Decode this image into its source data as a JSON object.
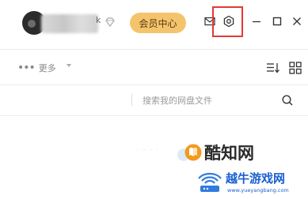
{
  "titlebar": {
    "username_suffix": "k",
    "member_center_label": "会员中心"
  },
  "icons": {
    "mail": "mail-icon",
    "settings": "gear-icon",
    "minimize": "minimize-icon",
    "maximize": "maximize-icon",
    "close": "close-icon",
    "diamond": "diamond-icon",
    "sort": "sort-icon",
    "grid": "grid-icon",
    "search": "search-icon"
  },
  "colors": {
    "member_btn_bg": "#f4c46d",
    "highlight_box": "#e53935",
    "watermark_blue": "#1a5fd0"
  },
  "toolbar": {
    "more_label": "更多"
  },
  "search": {
    "placeholder": "搜索我的网盘文件",
    "value": ""
  },
  "watermarks": {
    "site1": "酷知网",
    "site2": "越牛游戏网",
    "site2_url": "www.yueyangbang.com"
  }
}
